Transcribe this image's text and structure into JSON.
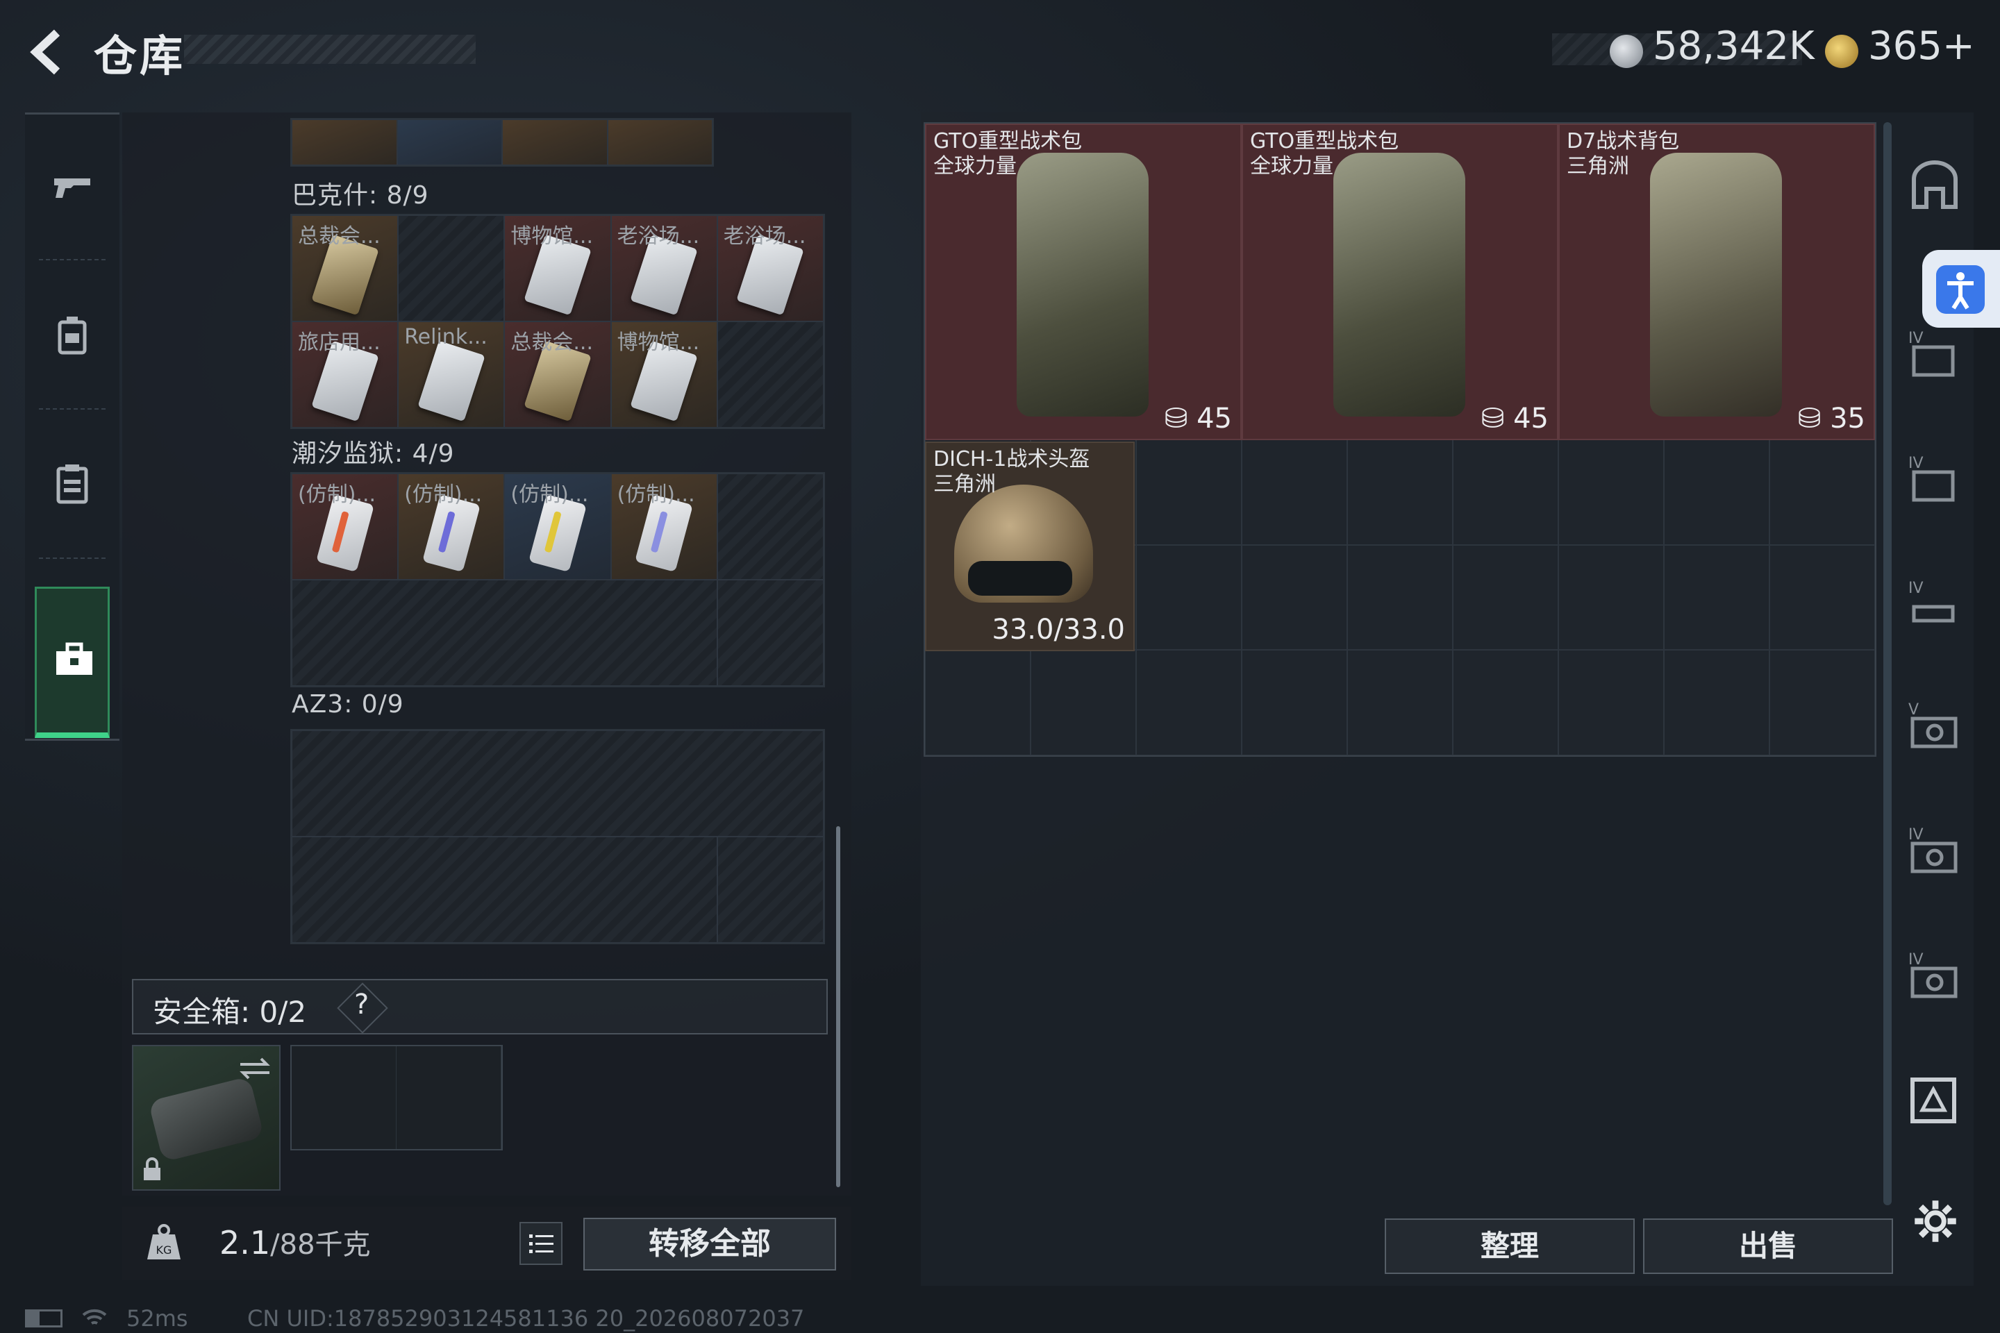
{
  "header": {
    "title": "仓库",
    "currency1": "58,342K",
    "currency2": "365+"
  },
  "sections": [
    {
      "label": "巴克什: 8/9",
      "items": [
        "总裁会...",
        "",
        "博物馆...",
        "老浴场...",
        "老浴场...",
        "旅店用...",
        "Relink...",
        "总裁会...",
        "博物馆...",
        ""
      ]
    },
    {
      "label": "潮汐监狱: 4/9",
      "items": [
        "(仿制)...",
        "(仿制)...",
        "(仿制)...",
        "(仿制)..."
      ]
    },
    {
      "label": "AZ3: 0/9"
    }
  ],
  "safe": {
    "label": "安全箱: 0/2",
    "help": "?"
  },
  "footer": {
    "weight": "2.1",
    "weight_cap": "/88千克",
    "transfer_label": "转移全部"
  },
  "stash_items": [
    {
      "name": "GTO重型战术包\n全球力量",
      "value": "45"
    },
    {
      "name": "GTO重型战术包\n全球力量",
      "value": "45"
    },
    {
      "name": "D7战术背包\n三角洲",
      "value": "35"
    },
    {
      "name": "DICH-1战术头盔\n三角洲",
      "value": "33.0/33.0"
    }
  ],
  "buttons": {
    "sort": "整理",
    "sell": "出售"
  },
  "side_icons": [
    "armor-icon",
    "backpack-icon",
    "chest-rig-icon",
    "helmet-icon",
    "gear-icon-1",
    "gear-icon-2",
    "gear-icon-3",
    "stash-icon"
  ],
  "status": {
    "ping": "52ms",
    "uid": "CN UID:187852903124581136 20_202608072037"
  },
  "colors": {
    "accent": "#3fd289",
    "red_item": "#4a2a2e",
    "access": "#3a78ea"
  }
}
